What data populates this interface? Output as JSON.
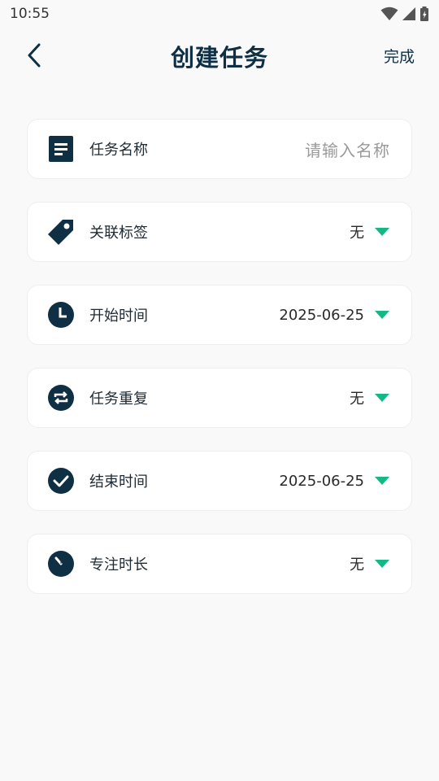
{
  "status": {
    "time": "10:55"
  },
  "header": {
    "title": "创建任务",
    "done_label": "完成"
  },
  "fields": {
    "name": {
      "label": "任务名称",
      "placeholder": "请输入名称"
    },
    "tag": {
      "label": "关联标签",
      "value": "无"
    },
    "start": {
      "label": "开始时间",
      "value": "2025-06-25"
    },
    "repeat": {
      "label": "任务重复",
      "value": "无"
    },
    "end": {
      "label": "结束时间",
      "value": "2025-06-25"
    },
    "focus": {
      "label": "专注时长",
      "value": "无"
    }
  },
  "colors": {
    "primary": "#0f2f44",
    "accent": "#12b886",
    "background": "#f9f9f9"
  },
  "icons": {
    "back": "chevron-left-icon",
    "name": "document-icon",
    "tag": "tag-icon",
    "start": "clock-icon",
    "repeat": "repeat-icon",
    "end": "check-circle-icon",
    "focus": "timer-icon",
    "caret": "caret-down-icon"
  }
}
